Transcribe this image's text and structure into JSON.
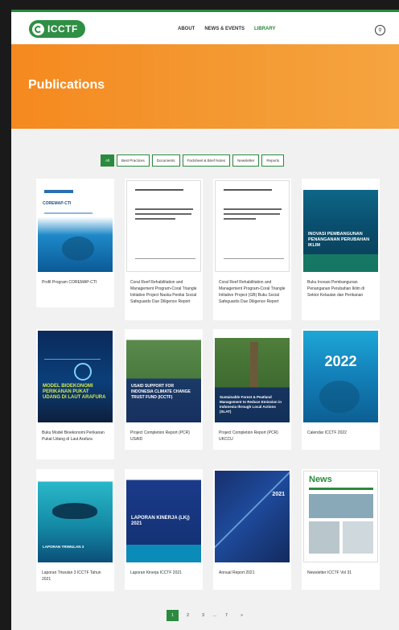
{
  "nav": {
    "logo": "ICCTF",
    "links": [
      "ABOUT",
      "NEWS & EVENTS",
      "LIBRARY"
    ]
  },
  "hero": {
    "title": "Publications"
  },
  "filters": [
    "All",
    "Best Practices",
    "Documents",
    "Factsheet & Brief Notes",
    "Newsletter",
    "Reports"
  ],
  "publications": [
    {
      "title": "Profil Program COREMAP-CTI",
      "cover_title": "COREMAP-CTI"
    },
    {
      "title": "Coral Reef Rehabilitation and Management Program-Coral Triangle Initiative Project Naska Penilai Social Safeguards Due Diligence Report",
      "cover_title": ""
    },
    {
      "title": "Coral Reef Rehabilitation and Management Program-Coral Triangle Initiative Project (GB) Buku Social Safeguards Due Diligence Report",
      "cover_title": ""
    },
    {
      "title": "Buku Inovasi Pembangunan Penanganan Perubahan Iklim di Sektor Kelautan dan Perikanan",
      "cover_title": "INOVASI PEMBANGUNAN PENANGANAN PERUBAHAN IKLIM"
    },
    {
      "title": "Buku Model Bioekonomi Perikanan Pukat Udang di Laut Arafura",
      "cover_title": "MODEL BIOEKONOMI PERIKANAN PUKAT UDANG DI LAUT ARAFURA"
    },
    {
      "title": "Project Completion Report (PCR) USAID",
      "cover_title": "USAID SUPPORT FOR INDONESIA CLIMATE CHANGE TRUST FUND (ICCTF)"
    },
    {
      "title": "Project Completion Report (PCR) UKCCU",
      "cover_title": "Sustainable Forest & Peatland Management to Reduce Emission in Indonesia through Local Actions (SLAT)"
    },
    {
      "title": "Calendar ICCTF 2022",
      "cover_title": "2022"
    },
    {
      "title": "Laporan Triwulan 3 ICCTF Tahun 2021",
      "cover_title": "LAPORAN TRIWULAN 3"
    },
    {
      "title": "Laporan Kinerja ICCTF 2021",
      "cover_title": "LAPORAN KINERJA (LKj) 2021"
    },
    {
      "title": "Annual Report 2021",
      "cover_title": "2021"
    },
    {
      "title": "Newsletter ICCTF Vol 31",
      "cover_title": "News"
    }
  ],
  "pagination": [
    "1",
    "2",
    "3",
    "...",
    "7",
    "»"
  ]
}
